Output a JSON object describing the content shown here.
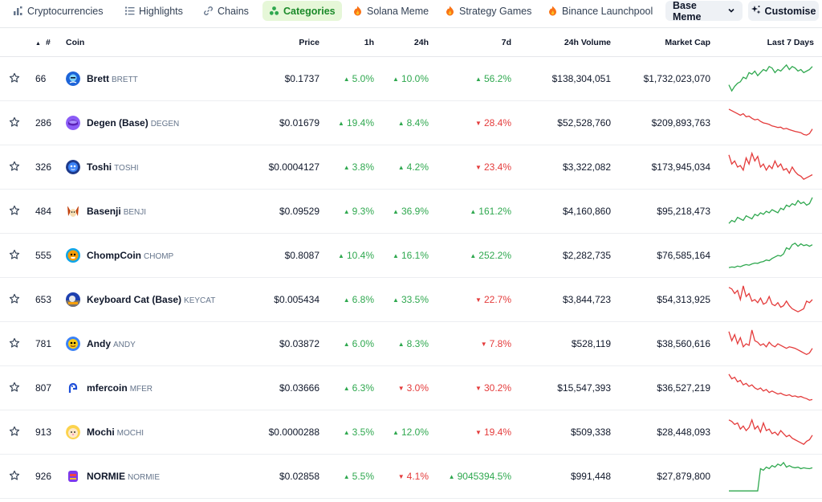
{
  "nav": {
    "tabs": [
      {
        "label": "Cryptocurrencies",
        "icon": "bar-chart-icon"
      },
      {
        "label": "Highlights",
        "icon": "list-icon"
      },
      {
        "label": "Chains",
        "icon": "link-icon"
      },
      {
        "label": "Categories",
        "icon": "categories-icon"
      },
      {
        "label": "Solana Meme",
        "icon": "fire-icon"
      },
      {
        "label": "Strategy Games",
        "icon": "fire-icon"
      },
      {
        "label": "Binance Launchpool",
        "icon": "fire-icon"
      }
    ],
    "active_tab": "Categories",
    "dropdown_value": "Base Meme",
    "customise_label": "Customise"
  },
  "columns": {
    "rank": "#",
    "coin": "Coin",
    "price": "Price",
    "h1": "1h",
    "h24": "24h",
    "d7": "7d",
    "volume": "24h Volume",
    "market_cap": "Market Cap",
    "last7": "Last 7 Days"
  },
  "colors": {
    "accent": "#1b8a2a",
    "up": "#2fa84f",
    "down": "#e43b3b"
  },
  "rows": [
    {
      "rank": "66",
      "name": "Brett",
      "symbol": "BRETT",
      "price": "$0.1737",
      "h1": "5.0%",
      "h1_dir": "up",
      "h24": "10.0%",
      "h24_dir": "up",
      "d7": "56.2%",
      "d7_dir": "up",
      "volume": "$138,304,051",
      "market_cap": "$1,732,023,070",
      "spark": [
        0.3,
        0.1,
        0.25,
        0.35,
        0.4,
        0.55,
        0.5,
        0.7,
        0.65,
        0.75,
        0.6,
        0.7,
        0.8,
        0.75,
        0.9,
        0.85,
        0.7,
        0.8,
        0.75,
        0.85,
        0.95,
        0.8,
        0.9,
        0.85,
        0.75,
        0.8,
        0.7,
        0.75,
        0.8,
        0.9
      ]
    },
    {
      "rank": "286",
      "name": "Degen (Base)",
      "symbol": "DEGEN",
      "price": "$0.01679",
      "h1": "19.4%",
      "h1_dir": "up",
      "h24": "8.4%",
      "h24_dir": "up",
      "d7": "28.4%",
      "d7_dir": "down",
      "volume": "$52,528,760",
      "market_cap": "$209,893,763",
      "spark": [
        0.95,
        0.9,
        0.85,
        0.8,
        0.75,
        0.8,
        0.7,
        0.72,
        0.65,
        0.6,
        0.62,
        0.55,
        0.5,
        0.48,
        0.45,
        0.4,
        0.38,
        0.35,
        0.36,
        0.3,
        0.32,
        0.28,
        0.25,
        0.22,
        0.2,
        0.18,
        0.12,
        0.1,
        0.15,
        0.3
      ]
    },
    {
      "rank": "326",
      "name": "Toshi",
      "symbol": "TOSHI",
      "price": "$0.0004127",
      "h1": "3.8%",
      "h1_dir": "up",
      "h24": "4.2%",
      "h24_dir": "up",
      "d7": "23.4%",
      "d7_dir": "down",
      "volume": "$3,322,082",
      "market_cap": "$173,945,034",
      "spark": [
        0.9,
        0.6,
        0.7,
        0.5,
        0.55,
        0.4,
        0.8,
        0.6,
        0.95,
        0.7,
        0.85,
        0.5,
        0.6,
        0.4,
        0.55,
        0.45,
        0.7,
        0.5,
        0.6,
        0.4,
        0.45,
        0.3,
        0.5,
        0.35,
        0.25,
        0.2,
        0.1,
        0.15,
        0.2,
        0.25
      ]
    },
    {
      "rank": "484",
      "name": "Basenji",
      "symbol": "BENJI",
      "price": "$0.09529",
      "h1": "9.3%",
      "h1_dir": "up",
      "h24": "36.9%",
      "h24_dir": "up",
      "d7": "161.2%",
      "d7_dir": "up",
      "volume": "$4,160,860",
      "market_cap": "$95,218,473",
      "spark": [
        0.1,
        0.2,
        0.15,
        0.3,
        0.25,
        0.2,
        0.35,
        0.3,
        0.25,
        0.4,
        0.35,
        0.45,
        0.4,
        0.5,
        0.45,
        0.55,
        0.5,
        0.45,
        0.6,
        0.55,
        0.7,
        0.65,
        0.75,
        0.7,
        0.85,
        0.75,
        0.8,
        0.7,
        0.75,
        0.95
      ]
    },
    {
      "rank": "555",
      "name": "ChompCoin",
      "symbol": "CHOMP",
      "price": "$0.8087",
      "h1": "10.4%",
      "h1_dir": "up",
      "h24": "16.1%",
      "h24_dir": "up",
      "d7": "252.2%",
      "d7_dir": "up",
      "volume": "$2,282,735",
      "market_cap": "$76,585,164",
      "spark": [
        0.1,
        0.12,
        0.11,
        0.15,
        0.13,
        0.17,
        0.2,
        0.18,
        0.22,
        0.25,
        0.24,
        0.28,
        0.3,
        0.35,
        0.33,
        0.4,
        0.45,
        0.5,
        0.48,
        0.55,
        0.75,
        0.7,
        0.85,
        0.9,
        0.8,
        0.88,
        0.82,
        0.85,
        0.8,
        0.85
      ]
    },
    {
      "rank": "653",
      "name": "Keyboard Cat (Base)",
      "symbol": "KEYCAT",
      "price": "$0.005434",
      "h1": "6.8%",
      "h1_dir": "up",
      "h24": "33.5%",
      "h24_dir": "up",
      "d7": "22.7%",
      "d7_dir": "down",
      "volume": "$3,844,723",
      "market_cap": "$54,313,925",
      "spark": [
        0.9,
        0.85,
        0.7,
        0.8,
        0.5,
        0.95,
        0.6,
        0.7,
        0.45,
        0.5,
        0.4,
        0.55,
        0.35,
        0.4,
        0.6,
        0.35,
        0.3,
        0.4,
        0.25,
        0.3,
        0.45,
        0.3,
        0.2,
        0.15,
        0.1,
        0.15,
        0.2,
        0.45,
        0.4,
        0.5
      ]
    },
    {
      "rank": "781",
      "name": "Andy",
      "symbol": "ANDY",
      "price": "$0.03872",
      "h1": "6.0%",
      "h1_dir": "up",
      "h24": "8.3%",
      "h24_dir": "up",
      "d7": "7.8%",
      "d7_dir": "down",
      "volume": "$528,119",
      "market_cap": "$38,560,616",
      "spark": [
        0.9,
        0.6,
        0.8,
        0.5,
        0.7,
        0.4,
        0.5,
        0.45,
        0.95,
        0.6,
        0.55,
        0.45,
        0.5,
        0.4,
        0.55,
        0.45,
        0.4,
        0.5,
        0.45,
        0.4,
        0.35,
        0.4,
        0.38,
        0.35,
        0.3,
        0.25,
        0.2,
        0.15,
        0.2,
        0.35
      ]
    },
    {
      "rank": "807",
      "name": "mfercoin",
      "symbol": "MFER",
      "price": "$0.03666",
      "h1": "6.3%",
      "h1_dir": "up",
      "h24": "3.0%",
      "h24_dir": "down",
      "d7": "30.2%",
      "d7_dir": "down",
      "volume": "$15,547,393",
      "market_cap": "$36,527,219",
      "spark": [
        0.95,
        0.8,
        0.85,
        0.7,
        0.75,
        0.6,
        0.65,
        0.55,
        0.6,
        0.5,
        0.45,
        0.5,
        0.4,
        0.45,
        0.35,
        0.4,
        0.35,
        0.3,
        0.33,
        0.28,
        0.25,
        0.28,
        0.22,
        0.24,
        0.2,
        0.22,
        0.18,
        0.15,
        0.1,
        0.12
      ]
    },
    {
      "rank": "913",
      "name": "Mochi",
      "symbol": "MOCHI",
      "price": "$0.0000288",
      "h1": "3.5%",
      "h1_dir": "up",
      "h24": "12.0%",
      "h24_dir": "up",
      "d7": "19.4%",
      "d7_dir": "down",
      "volume": "$509,338",
      "market_cap": "$28,448,093",
      "spark": [
        0.9,
        0.85,
        0.75,
        0.8,
        0.6,
        0.7,
        0.55,
        0.65,
        0.9,
        0.6,
        0.7,
        0.5,
        0.8,
        0.55,
        0.6,
        0.45,
        0.5,
        0.4,
        0.55,
        0.45,
        0.35,
        0.4,
        0.3,
        0.25,
        0.2,
        0.15,
        0.1,
        0.2,
        0.25,
        0.4
      ]
    },
    {
      "rank": "926",
      "name": "NORMIE",
      "symbol": "NORMIE",
      "price": "$0.02858",
      "h1": "5.5%",
      "h1_dir": "up",
      "h24": "4.1%",
      "h24_dir": "down",
      "d7": "9045394.5%",
      "d7_dir": "up",
      "volume": "$991,448",
      "market_cap": "$27,879,800",
      "spark": [
        0.02,
        0.02,
        0.02,
        0.02,
        0.02,
        0.02,
        0.02,
        0.02,
        0.02,
        0.02,
        0.02,
        0.75,
        0.7,
        0.8,
        0.75,
        0.85,
        0.8,
        0.9,
        0.85,
        0.95,
        0.8,
        0.85,
        0.8,
        0.78,
        0.8,
        0.75,
        0.78,
        0.76,
        0.75,
        0.78
      ]
    }
  ]
}
